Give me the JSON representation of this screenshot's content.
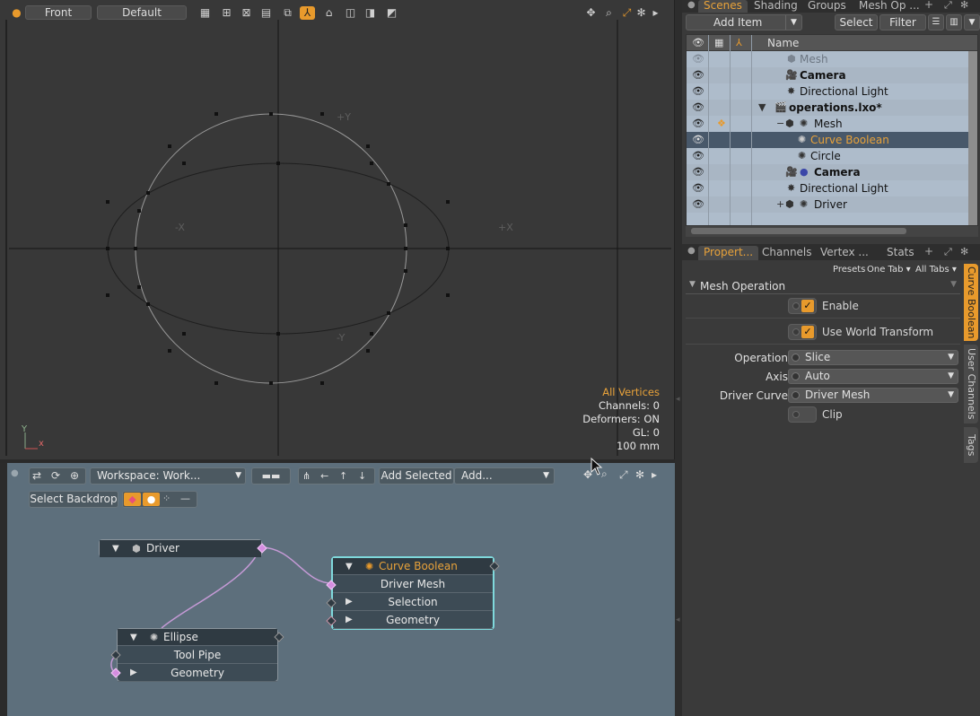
{
  "viewport": {
    "view_dropdown": "Front",
    "style_dropdown": "Default",
    "axis_labels": {
      "py": "+Y",
      "ny": "-Y",
      "px": "+X",
      "nx": "-X"
    },
    "gizmo": {
      "y": "Y",
      "x": "x"
    },
    "readout": {
      "mode": "All Vertices",
      "channels": "Channels: 0",
      "deformers": "Deformers: ON",
      "gl": "GL: 0",
      "scale": "100 mm"
    }
  },
  "node_editor": {
    "workspace": "Workspace: Work...",
    "add_selected": "Add Selected",
    "add": "Add...",
    "select_backdrop": "Select Backdrop",
    "nodes": {
      "driver": {
        "title": "Driver"
      },
      "curve_boolean": {
        "title": "Curve Boolean",
        "rows": [
          "Driver Mesh",
          "Selection",
          "Geometry"
        ]
      },
      "ellipse": {
        "title": "Ellipse",
        "rows": [
          "Tool Pipe",
          "Geometry"
        ]
      }
    }
  },
  "scenes_panel": {
    "tabs": [
      "Scenes",
      "Shading",
      "Groups",
      "Mesh Op ..."
    ],
    "add_item": "Add Item",
    "select": "Select",
    "filter": "Filter",
    "name_header": "Name",
    "rows": [
      {
        "label": "Mesh"
      },
      {
        "label": "Camera"
      },
      {
        "label": "Directional Light"
      },
      {
        "label": "operations.lxo*"
      },
      {
        "label": "Mesh"
      },
      {
        "label": "Curve Boolean"
      },
      {
        "label": "Circle"
      },
      {
        "label": "Camera"
      },
      {
        "label": "Directional Light"
      },
      {
        "label": "Driver"
      }
    ]
  },
  "properties_panel": {
    "tabs": [
      "Propert...",
      "Channels",
      "Vertex ...",
      "Stats"
    ],
    "presets": "Presets",
    "one_tab": "One Tab",
    "all_tabs": "All Tabs",
    "section": "Mesh Operation",
    "enable": "Enable",
    "use_world_transform": "Use World Transform",
    "operation_label": "Operation",
    "operation_value": "Slice",
    "axis_label": "Axis",
    "axis_value": "Auto",
    "driver_curve_label": "Driver Curve",
    "driver_curve_value": "Driver Mesh",
    "clip": "Clip",
    "side_tabs": [
      "Curve Boolean",
      "User Channels",
      "Tags"
    ]
  }
}
